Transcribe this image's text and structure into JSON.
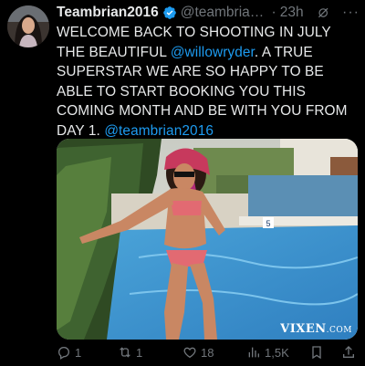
{
  "tweet": {
    "display_name": "Teambrian2016",
    "handle": "@teambrian2...",
    "time": "23h",
    "body": {
      "line_a": "WELCOME BACK TO SHOOTING IN JULY THE BEAUTIFUL ",
      "mention_1": "@willowryder",
      "line_b": ".  A TRUE SUPERSTAR WE ARE SO HAPPY TO BE ABLE TO START BOOKING YOU THIS COMING MONTH AND BE WITH YOU FROM DAY 1. ",
      "mention_2": "@teambrian2016"
    },
    "media": {
      "watermark": "VIXEN",
      "watermark_suffix": ".COM",
      "pool_marker": "5"
    },
    "actions": {
      "replies": "1",
      "reposts": "1",
      "likes": "18",
      "views": "1,5K"
    }
  },
  "colors": {
    "background": "#000000",
    "text": "#e7e9ea",
    "muted": "#71767b",
    "link": "#1d9bf0",
    "verified": "#1d9bf0"
  },
  "icons": {
    "verified": "verified-badge-icon",
    "grok": "grok-icon",
    "more": "more-icon",
    "reply": "reply-icon",
    "repost": "repost-icon",
    "like": "heart-icon",
    "views": "views-icon",
    "bookmark": "bookmark-icon",
    "share": "share-icon"
  }
}
